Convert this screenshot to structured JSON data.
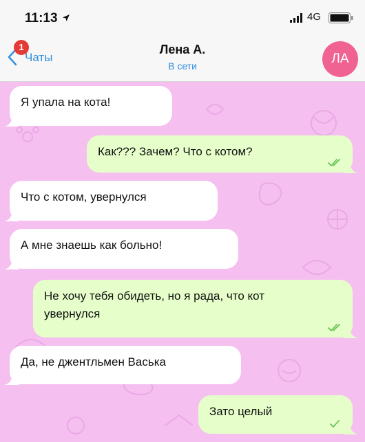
{
  "status_bar": {
    "time": "11:13",
    "network": "4G",
    "icons": [
      "location-arrow-icon",
      "signal-bars-icon",
      "battery-icon"
    ]
  },
  "header": {
    "back_label": "Чаты",
    "unread_count": "1",
    "contact_name": "Лена А.",
    "contact_status": "В сети",
    "avatar_initials": "ЛА",
    "icons": [
      "chevron-left-icon"
    ]
  },
  "colors": {
    "accent": "#2f8fe0",
    "badge": "#e53935",
    "avatar": "#f06292",
    "chat_background": "#f5bff0",
    "incoming_bubble": "#ffffff",
    "outgoing_bubble": "#e6ffca",
    "read_check": "#5bbf4a"
  },
  "messages": [
    {
      "direction": "in",
      "text": "Я упала на кота!"
    },
    {
      "direction": "out",
      "text": "Как??? Зачем? Что с котом?",
      "status": "read-double-check-icon"
    },
    {
      "direction": "in",
      "text": "Что с котом, увернулся"
    },
    {
      "direction": "in",
      "text": "А мне знаешь как больно!"
    },
    {
      "direction": "out",
      "text": "Не хочу тебя обидеть, но я рада, что кот увернулся",
      "status": "read-double-check-icon"
    },
    {
      "direction": "in",
      "text": "Да, не джентльмен Васька"
    },
    {
      "direction": "out",
      "text": "Зато целый",
      "status": "read-single-check-icon"
    }
  ]
}
